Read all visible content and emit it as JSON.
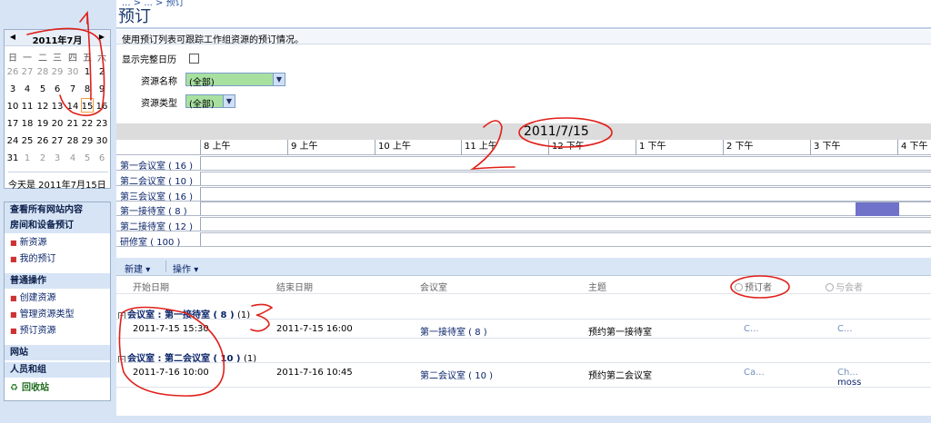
{
  "page": {
    "breadcrumb": "... > ... > 预订",
    "title": "预订",
    "description": "使用预订列表可跟踪工作组资源的预订情况。"
  },
  "calendar": {
    "prev": "◀",
    "next": "▶",
    "title": "2011年7月",
    "daynames": [
      "日",
      "一",
      "二",
      "三",
      "四",
      "五",
      "六"
    ],
    "weeks": [
      [
        "26",
        "27",
        "28",
        "29",
        "30",
        "1",
        "2"
      ],
      [
        "3",
        "4",
        "5",
        "6",
        "7",
        "8",
        "9"
      ],
      [
        "10",
        "11",
        "12",
        "13",
        "14",
        "15",
        "16"
      ],
      [
        "17",
        "18",
        "19",
        "20",
        "21",
        "22",
        "23"
      ],
      [
        "24",
        "25",
        "26",
        "27",
        "28",
        "29",
        "30"
      ],
      [
        "31",
        "1",
        "2",
        "3",
        "4",
        "5",
        "6"
      ]
    ],
    "today_text": "今天是 2011年7月15日"
  },
  "quicklaunch": {
    "view_all": "查看所有网站内容",
    "sec1": "房间和设备预订",
    "new_resource": "新资源",
    "my_bookings": "我的预订",
    "sec2": "普通操作",
    "create_resource": "创建资源",
    "manage_types": "管理资源类型",
    "book_resource": "预订资源",
    "sites": "网站",
    "people": "人员和组",
    "recycle": "回收站"
  },
  "filters": {
    "full_calendar": "显示完整日历",
    "resource_name_label": "资源名称",
    "resource_name_value": "(全部)",
    "resource_type_label": "资源类型",
    "resource_type_value": "(全部)"
  },
  "timeline": {
    "date": "2011/7/15",
    "hours": [
      "8 上午",
      "9 上午",
      "10 上午",
      "11 上午",
      "12 下午",
      "1 下午",
      "2 下午",
      "3 下午",
      "4 下午"
    ],
    "rooms": [
      "第一会议室 ( 16 )",
      "第二会议室 ( 10 )",
      "第三会议室 ( 16 )",
      "第一接待室 ( 8 )",
      "第二接待室 ( 12 )",
      "研修室 ( 100 )"
    ]
  },
  "toolbar": {
    "new": "新建",
    "actions": "操作"
  },
  "columns": {
    "start": "开始日期",
    "end": "结束日期",
    "room": "会议室",
    "subject": "主题",
    "booker": "预订者",
    "attendees": "与会者"
  },
  "groups": [
    {
      "prefix": "会议室 : ",
      "name": "第一接待室 ( 8 )",
      "count": "(1)",
      "row": {
        "start": "2011-7-15 15:30",
        "end": "2011-7-15 16:00",
        "room": "第一接待室 ( 8 )",
        "subject": "预约第一接待室",
        "booker": "C...",
        "attendee": "C..."
      }
    },
    {
      "prefix": "会议室 : ",
      "name": "第二会议室 ( 10 )",
      "count": "(1)",
      "row": {
        "start": "2011-7-16 10:00",
        "end": "2011-7-16 10:45",
        "room": "第二会议室 ( 10 )",
        "subject": "预约第二会议室",
        "booker": "Ca...",
        "attendee": "Ch...",
        "attendee2": "moss"
      }
    }
  ],
  "colors": {
    "booking_bar": "#6f72c8",
    "annotation": "#e0201a",
    "select_bg": "#a8e0a0"
  }
}
